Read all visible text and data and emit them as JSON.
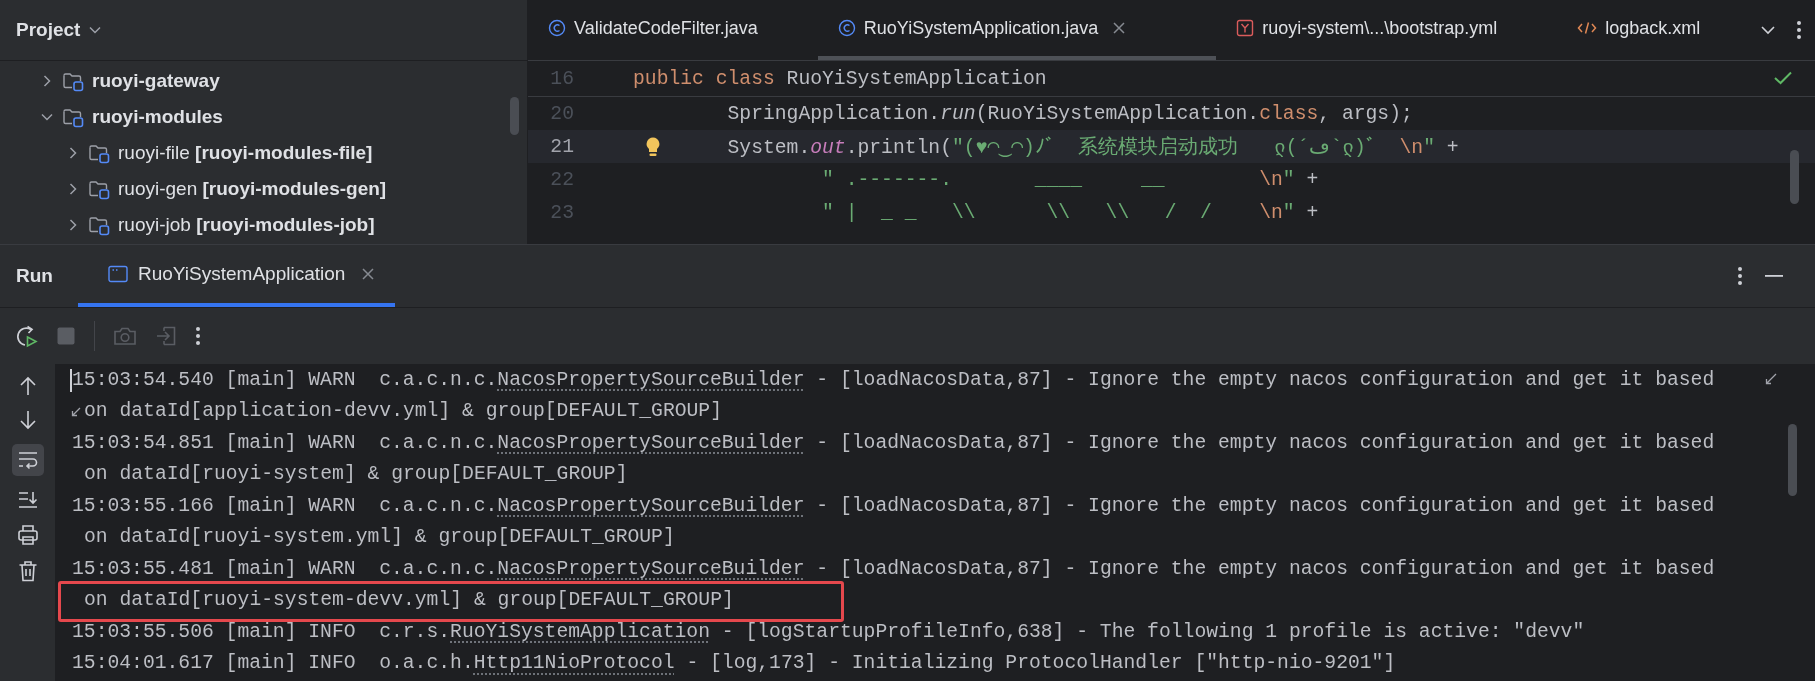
{
  "project": {
    "title": "Project",
    "tree": [
      {
        "name": "ruoyi-gateway",
        "expanded": false
      },
      {
        "name": "ruoyi-modules",
        "expanded": true,
        "children": [
          {
            "name": "ruoyi-file",
            "module": "[ruoyi-modules-file]",
            "expanded": false
          },
          {
            "name": "ruoyi-gen",
            "module": "[ruoyi-modules-gen]",
            "expanded": false
          },
          {
            "name": "ruoyi-job",
            "module": "[ruoyi-modules-job]",
            "expanded": false
          }
        ]
      }
    ]
  },
  "editor": {
    "tabs": [
      {
        "label": "ValidateCodeFilter.java",
        "kind": "class",
        "selected": false
      },
      {
        "label": "RuoYiSystemApplication.java",
        "kind": "class",
        "selected": true
      },
      {
        "label": "ruoyi-system\\...\\bootstrap.yml",
        "kind": "yaml",
        "selected": false
      },
      {
        "label": "logback.xml",
        "kind": "xml",
        "selected": false
      }
    ],
    "lines": [
      {
        "number": "16",
        "kind": "sticky",
        "current": false,
        "tokens": [
          {
            "text": "public class",
            "kind": "keyword"
          },
          {
            "text": " RuoYiSystemApplication",
            "kind": "plain"
          }
        ]
      },
      {
        "number": "20",
        "kind": "line",
        "current": false,
        "tokens": [
          {
            "text": "        SpringApplication.",
            "kind": "plain"
          },
          {
            "text": "run",
            "kind": "italic"
          },
          {
            "text": "(RuoYiSystemApplication.",
            "kind": "plain"
          },
          {
            "text": "class",
            "kind": "keyword"
          },
          {
            "text": ", args);",
            "kind": "plain"
          }
        ]
      },
      {
        "number": "21",
        "kind": "line",
        "current": true,
        "tokens": [
          {
            "text": "        System.",
            "kind": "plain"
          },
          {
            "text": "out",
            "kind": "field"
          },
          {
            "text": ".println(",
            "kind": "plain"
          },
          {
            "text": "\"(♥◠‿◠)ﾉﾞ  系统模块启动成功   ლ(´ڡ`ლ)ﾞ  ",
            "kind": "string"
          },
          {
            "text": "\\n",
            "kind": "escape"
          },
          {
            "text": "\"",
            "kind": "string"
          },
          {
            "text": " +",
            "kind": "plain"
          }
        ]
      },
      {
        "number": "22",
        "kind": "line",
        "current": false,
        "tokens": [
          {
            "text": "                \" .-------.       ____     __        ",
            "kind": "string"
          },
          {
            "text": "\\n",
            "kind": "escape"
          },
          {
            "text": "\"",
            "kind": "string"
          },
          {
            "text": " +",
            "kind": "plain"
          }
        ]
      },
      {
        "number": "23",
        "kind": "line",
        "current": false,
        "tokens": [
          {
            "text": "                \" |  _ _   \\\\      \\\\   \\\\   /  /    ",
            "kind": "string"
          },
          {
            "text": "\\n",
            "kind": "escape"
          },
          {
            "text": "\"",
            "kind": "string"
          },
          {
            "text": " +",
            "kind": "plain"
          }
        ]
      }
    ]
  },
  "run": {
    "title": "Run",
    "tabs": [
      {
        "label": "RuoYiSystemApplication",
        "selected": true
      }
    ],
    "rows": [
      {
        "kind": "entry",
        "before": "15:03:54.540 [main] WARN  c.a.c.n.c.",
        "link": "NacosPropertySourceBuilder",
        "after": " - [loadNacosData,87] - Ignore the empty nacos configuration and get it based",
        "wrap_mark": true,
        "caret": true,
        "highlighted": false
      },
      {
        "kind": "continuation",
        "text": "on dataId[application-devv.yml] & group[DEFAULT_GROUP]",
        "wrap_mark": true,
        "highlighted": false
      },
      {
        "kind": "entry",
        "before": "15:03:54.851 [main] WARN  c.a.c.n.c.",
        "link": "NacosPropertySourceBuilder",
        "after": " - [loadNacosData,87] - Ignore the empty nacos configuration and get it based",
        "wrap_mark": false,
        "caret": false,
        "highlighted": false
      },
      {
        "kind": "continuation",
        "text": "on dataId[ruoyi-system] & group[DEFAULT_GROUP]",
        "wrap_mark": false,
        "highlighted": false
      },
      {
        "kind": "entry",
        "before": "15:03:55.166 [main] WARN  c.a.c.n.c.",
        "link": "NacosPropertySourceBuilder",
        "after": " - [loadNacosData,87] - Ignore the empty nacos configuration and get it based",
        "wrap_mark": false,
        "caret": false,
        "highlighted": false
      },
      {
        "kind": "continuation",
        "text": "on dataId[ruoyi-system.yml] & group[DEFAULT_GROUP]",
        "wrap_mark": false,
        "highlighted": false
      },
      {
        "kind": "entry",
        "before": "15:03:55.481 [main] WARN  c.a.c.n.c.",
        "link": "NacosPropertySourceBuilder",
        "after": " - [loadNacosData,87] - Ignore the empty nacos configuration and get it based",
        "wrap_mark": false,
        "caret": false,
        "highlighted": false
      },
      {
        "kind": "continuation",
        "text": "on dataId[ruoyi-system-devv.yml] & group[DEFAULT_GROUP]",
        "wrap_mark": false,
        "highlighted": true
      },
      {
        "kind": "entry",
        "before": "15:03:55.506 [main] INFO  c.r.s.",
        "link": "RuoYiSystemApplication",
        "after": " - [logStartupProfileInfo,638] - The following 1 profile is active: \"devv\"",
        "wrap_mark": false,
        "caret": false,
        "highlighted": false
      },
      {
        "kind": "entry",
        "before": "15:04:01.617 [main] INFO  o.a.c.h.",
        "link": "Http11NioProtocol",
        "after": " - [log,173] - Initializing ProtocolHandler [\"http-nio-9201\"]",
        "wrap_mark": false,
        "caret": false,
        "highlighted": false
      }
    ]
  }
}
